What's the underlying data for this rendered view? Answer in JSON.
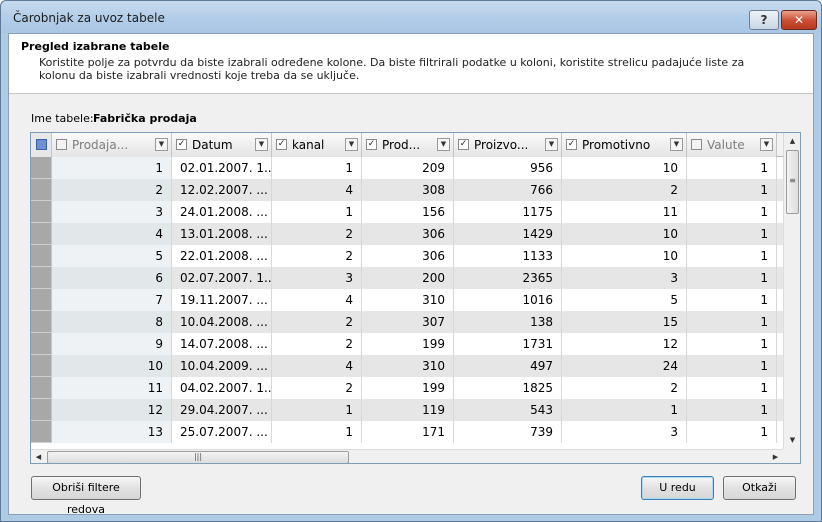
{
  "window": {
    "title": "Čarobnjak za uvoz tabele",
    "help_label": "?",
    "close_label": "✕"
  },
  "header": {
    "title": "Pregled izabrane tabele",
    "description": "Koristite polje za potvrdu da biste izabrali određene kolone. Da biste filtrirali podatke u koloni, koristite strelicu padajuće liste za kolonu da biste izabrali vrednosti koje treba da se uključe."
  },
  "table_name": {
    "label": "Ime tabele:",
    "value": "Fabrička prodaja"
  },
  "grid": {
    "columns": [
      {
        "label": "Prodaja...",
        "checked": false
      },
      {
        "label": "Datum",
        "checked": true
      },
      {
        "label": "kanal",
        "checked": true
      },
      {
        "label": "Prod...",
        "checked": true
      },
      {
        "label": "Proizvo...",
        "checked": true
      },
      {
        "label": "Promotivno",
        "checked": true
      },
      {
        "label": "Valute",
        "checked": false
      }
    ],
    "rows": [
      [
        "1",
        "02.01.2007. 1...",
        "1",
        "209",
        "956",
        "10",
        "1"
      ],
      [
        "2",
        "12.02.2007. ...",
        "4",
        "308",
        "766",
        "2",
        "1"
      ],
      [
        "3",
        "24.01.2008. ...",
        "1",
        "156",
        "1175",
        "11",
        "1"
      ],
      [
        "4",
        "13.01.2008. ...",
        "2",
        "306",
        "1429",
        "10",
        "1"
      ],
      [
        "5",
        "22.01.2008. ...",
        "2",
        "306",
        "1133",
        "10",
        "1"
      ],
      [
        "6",
        "02.07.2007. 1...",
        "3",
        "200",
        "2365",
        "3",
        "1"
      ],
      [
        "7",
        "19.11.2007. ...",
        "4",
        "310",
        "1016",
        "5",
        "1"
      ],
      [
        "8",
        "10.04.2008. ...",
        "2",
        "307",
        "138",
        "15",
        "1"
      ],
      [
        "9",
        "14.07.2008. ...",
        "2",
        "199",
        "1731",
        "12",
        "1"
      ],
      [
        "10",
        "10.04.2009. ...",
        "4",
        "310",
        "497",
        "24",
        "1"
      ],
      [
        "11",
        "04.02.2007. 1...",
        "2",
        "199",
        "1825",
        "2",
        "1"
      ],
      [
        "12",
        "29.04.2007. ...",
        "1",
        "119",
        "543",
        "1",
        "1"
      ],
      [
        "13",
        "25.07.2007. ...",
        "1",
        "171",
        "739",
        "3",
        "1"
      ]
    ]
  },
  "buttons": {
    "clear_filters": "Obriši filtere redova",
    "ok": "U redu",
    "cancel": "Otkaži"
  }
}
